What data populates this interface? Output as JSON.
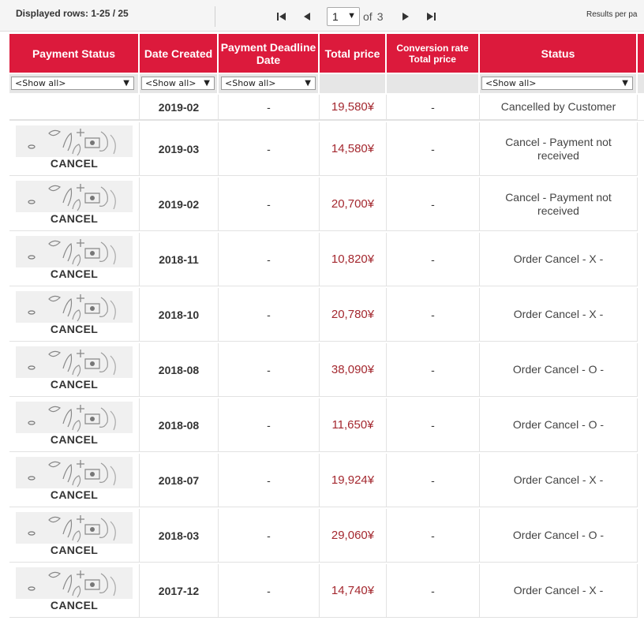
{
  "pager": {
    "rows_label": "Displayed rows: 1-25 / 25",
    "current_page": "1",
    "of_label": "of",
    "total_pages": "3",
    "results_per_page_label": "Results per pa"
  },
  "columns": {
    "payment_status": "Payment Status",
    "date_created": "Date Created",
    "payment_deadline": "Payment Deadline Date",
    "total_price": "Total price",
    "conversion_rate": "Conversion rate Total price",
    "status": "Status"
  },
  "filters": {
    "payment_status": "<Show all>",
    "date_created": "<Show all>",
    "payment_deadline": "<Show all>",
    "status": "<Show all>"
  },
  "cancel_label": "CANCEL",
  "colors": {
    "header_red": "#dc1a3c",
    "price_red": "#a4282f"
  },
  "rows": [
    {
      "payment": "",
      "date": "2019-02",
      "deadline": "-",
      "price": "19,580¥",
      "conversion": "-",
      "status": "Cancelled by Customer"
    },
    {
      "payment": "CANCEL",
      "date": "2019-03",
      "deadline": "-",
      "price": "14,580¥",
      "conversion": "-",
      "status": "Cancel - Payment not received"
    },
    {
      "payment": "CANCEL",
      "date": "2019-02",
      "deadline": "-",
      "price": "20,700¥",
      "conversion": "-",
      "status": "Cancel - Payment not received"
    },
    {
      "payment": "CANCEL",
      "date": "2018-11",
      "deadline": "-",
      "price": "10,820¥",
      "conversion": "-",
      "status": "Order Cancel - X -"
    },
    {
      "payment": "CANCEL",
      "date": "2018-10",
      "deadline": "-",
      "price": "20,780¥",
      "conversion": "-",
      "status": "Order Cancel - X -"
    },
    {
      "payment": "CANCEL",
      "date": "2018-08",
      "deadline": "-",
      "price": "38,090¥",
      "conversion": "-",
      "status": "Order Cancel - O -"
    },
    {
      "payment": "CANCEL",
      "date": "2018-08",
      "deadline": "-",
      "price": "11,650¥",
      "conversion": "-",
      "status": "Order Cancel - O -"
    },
    {
      "payment": "CANCEL",
      "date": "2018-07",
      "deadline": "-",
      "price": "19,924¥",
      "conversion": "-",
      "status": "Order Cancel - X -"
    },
    {
      "payment": "CANCEL",
      "date": "2018-03",
      "deadline": "-",
      "price": "29,060¥",
      "conversion": "-",
      "status": "Order Cancel - O -"
    },
    {
      "payment": "CANCEL",
      "date": "2017-12",
      "deadline": "-",
      "price": "14,740¥",
      "conversion": "-",
      "status": "Order Cancel - X -"
    }
  ]
}
